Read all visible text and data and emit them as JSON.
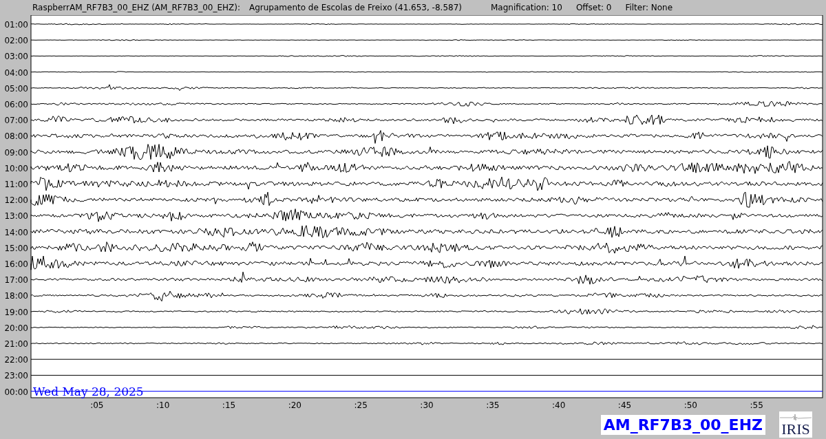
{
  "header": {
    "station": "RaspberrAM_RF7B3_00_EHZ (AM_RF7B3_00_EHZ):",
    "location": "Agrupamento de Escolas de Freixo (41.653, -8.587)",
    "magnification": "Magnification: 10",
    "offset": "Offset: 0",
    "filter": "Filter: None"
  },
  "plot": {
    "hour_labels": [
      "01:00",
      "02:00",
      "03:00",
      "04:00",
      "05:00",
      "06:00",
      "07:00",
      "08:00",
      "09:00",
      "10:00",
      "11:00",
      "12:00",
      "13:00",
      "14:00",
      "15:00",
      "16:00",
      "17:00",
      "18:00",
      "19:00",
      "20:00",
      "21:00",
      "22:00",
      "23:00",
      "00:00"
    ],
    "minute_labels": [
      ":05",
      ":10",
      ":15",
      ":20",
      ":25",
      ":30",
      ":35",
      ":40",
      ":45",
      ":50",
      ":55"
    ],
    "date": "Wed May 28, 2025"
  },
  "footer": {
    "channel": "AM_RF7B3_00_EHZ",
    "logo_text": "IRIS"
  }
}
